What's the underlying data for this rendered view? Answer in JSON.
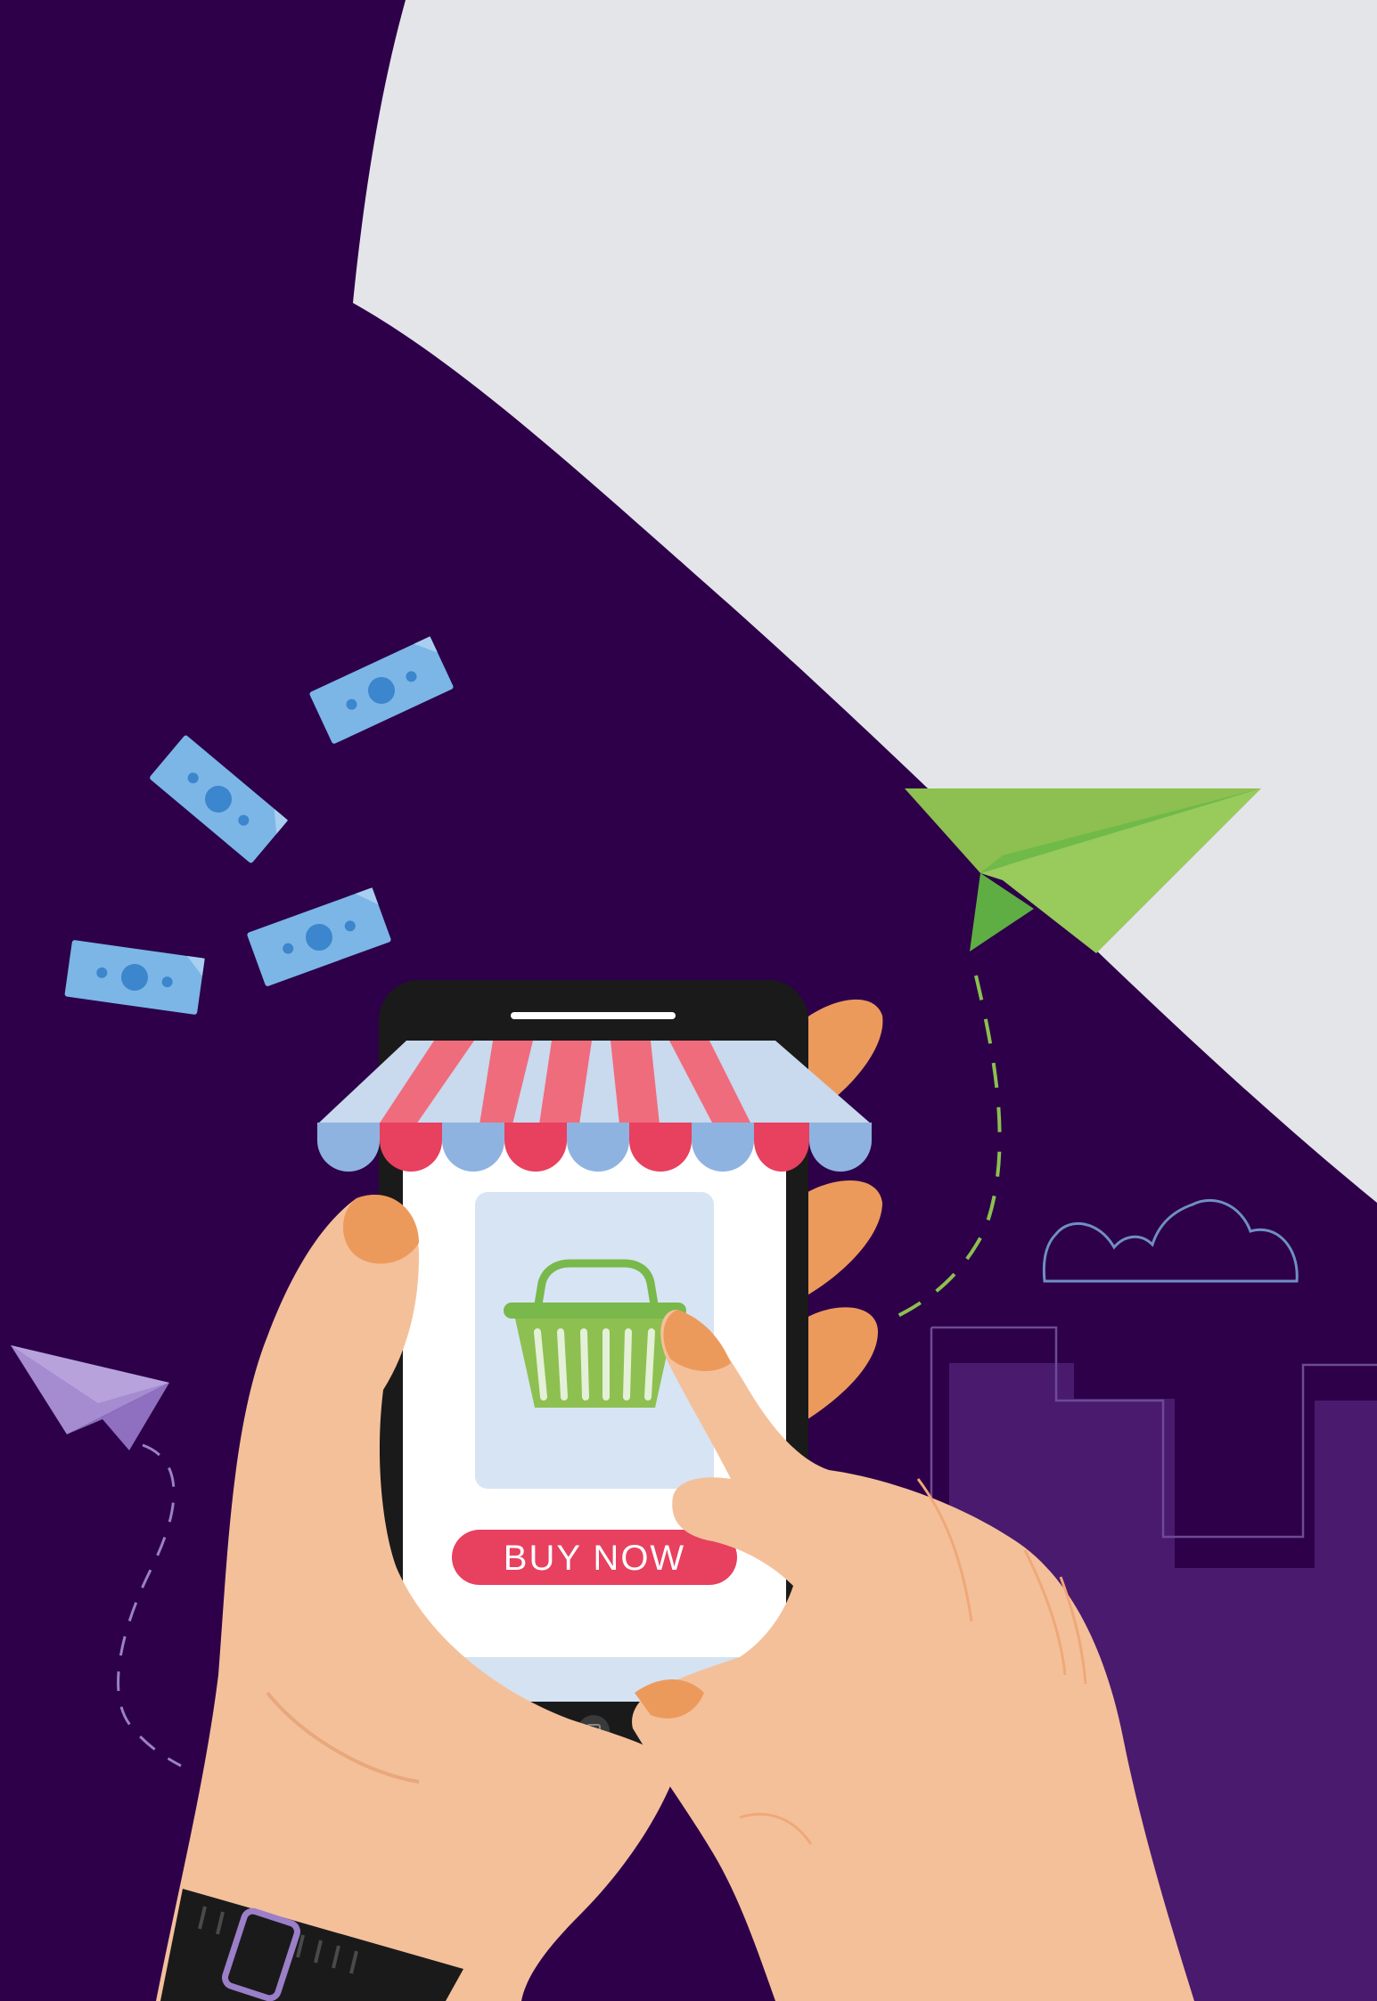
{
  "phone": {
    "buy_button_label": "BUY NOW"
  },
  "colors": {
    "background_purple": "#2d0049",
    "light_panel": "#e4e5e8",
    "accent_pink": "#e8405f",
    "basket_green": "#8dc050",
    "money_blue": "#7bb6e6",
    "skin": "#f4c09a"
  }
}
